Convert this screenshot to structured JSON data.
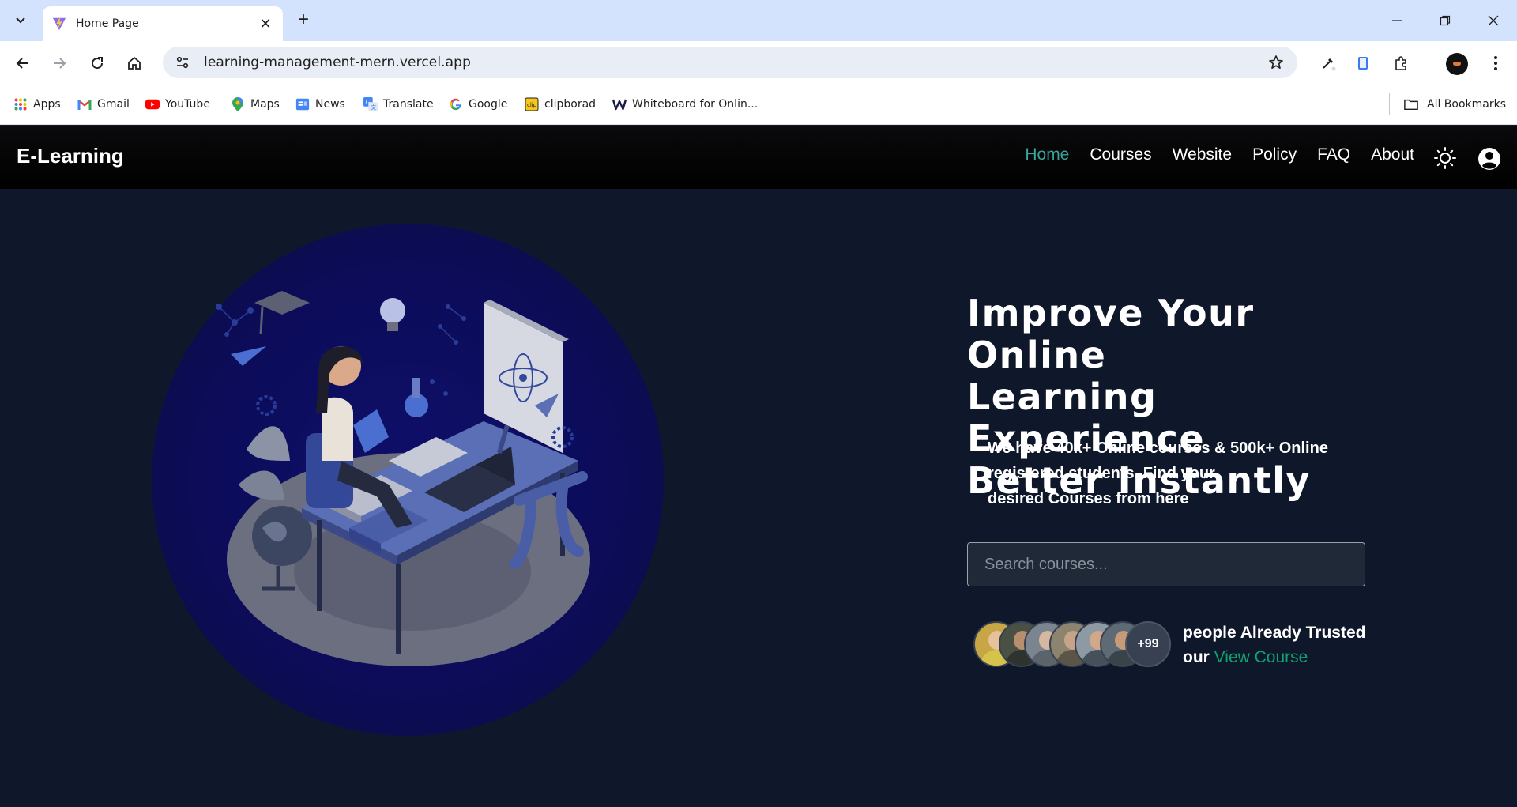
{
  "browser": {
    "tab": {
      "title": "Home Page"
    },
    "address_bar": {
      "url": "learning-management-mern.vercel.app"
    },
    "bookmarks": [
      {
        "label": "Apps",
        "icon": "apps-grid-icon"
      },
      {
        "label": "Gmail",
        "icon": "gmail-icon"
      },
      {
        "label": "YouTube",
        "icon": "youtube-icon"
      },
      {
        "label": "Maps",
        "icon": "maps-icon"
      },
      {
        "label": "News",
        "icon": "news-icon"
      },
      {
        "label": "Translate",
        "icon": "translate-icon"
      },
      {
        "label": "Google",
        "icon": "google-icon"
      },
      {
        "label": "clipborad",
        "icon": "clip-icon"
      },
      {
        "label": "Whiteboard for Onlin...",
        "icon": "whiteboard-icon"
      }
    ],
    "all_bookmarks": "All Bookmarks"
  },
  "site": {
    "brand": "E-Learning",
    "nav": [
      {
        "label": "Home",
        "active": true
      },
      {
        "label": "Courses",
        "active": false
      },
      {
        "label": "Website",
        "active": false
      },
      {
        "label": "Policy",
        "active": false
      },
      {
        "label": "FAQ",
        "active": false
      },
      {
        "label": "About",
        "active": false
      }
    ],
    "accent_color": "#37a39a",
    "link_color": "#0ea371"
  },
  "hero": {
    "headline": [
      "Improve Your Online",
      "Learning Experience",
      "Better Instantly"
    ],
    "subtext": [
      "We have 40k+ Online courses & 500k+ Online",
      "registered students. Find your",
      "desired Courses from here"
    ],
    "search_placeholder": "Search courses...",
    "avatar_more": "+99",
    "trust_text": "people Already Trusted our",
    "trust_link": "View Course"
  }
}
